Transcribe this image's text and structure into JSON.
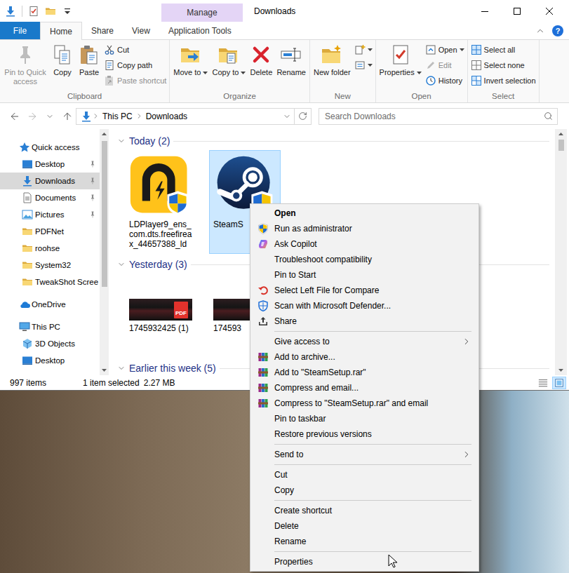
{
  "window": {
    "title": "Downloads",
    "context_tab": "Manage"
  },
  "ribbon": {
    "tabs": [
      {
        "label": "File",
        "kind": "file",
        "selected": false
      },
      {
        "label": "Home",
        "kind": "tab",
        "selected": true
      },
      {
        "label": "Share",
        "kind": "tab",
        "selected": false
      },
      {
        "label": "View",
        "kind": "tab",
        "selected": false
      },
      {
        "label": "Application Tools",
        "kind": "contextual",
        "selected": false
      }
    ],
    "help": "?",
    "groups": [
      {
        "label": "Clipboard",
        "buttons": [
          {
            "kind": "large",
            "label": "Pin to Quick access",
            "dropdown": false,
            "disabled": true
          },
          {
            "kind": "large",
            "label": "Copy",
            "dropdown": false,
            "disabled": false
          },
          {
            "kind": "large",
            "label": "Paste",
            "dropdown": false,
            "disabled": false
          },
          {
            "kind": "small",
            "label": "Cut",
            "dropdown": false,
            "disabled": false
          },
          {
            "kind": "small",
            "label": "Copy path",
            "dropdown": false,
            "disabled": false
          },
          {
            "kind": "small",
            "label": "Paste shortcut",
            "dropdown": false,
            "disabled": true
          }
        ]
      },
      {
        "label": "Organize",
        "buttons": [
          {
            "kind": "large",
            "label": "Move to",
            "dropdown": true,
            "disabled": false
          },
          {
            "kind": "large",
            "label": "Copy to",
            "dropdown": true,
            "disabled": false
          },
          {
            "kind": "large",
            "label": "Delete",
            "dropdown": false,
            "disabled": false
          },
          {
            "kind": "large",
            "label": "Rename",
            "dropdown": false,
            "disabled": false
          }
        ]
      },
      {
        "label": "New",
        "buttons": [
          {
            "kind": "large",
            "label": "New folder",
            "dropdown": false,
            "disabled": false
          },
          {
            "kind": "icon",
            "dropdown": true,
            "disabled": false
          },
          {
            "kind": "icon",
            "dropdown": true,
            "disabled": false
          }
        ]
      },
      {
        "label": "Open",
        "buttons": [
          {
            "kind": "large",
            "label": "Properties",
            "dropdown": true,
            "disabled": false
          },
          {
            "kind": "small",
            "label": "Open",
            "dropdown": true,
            "disabled": false
          },
          {
            "kind": "small",
            "label": "Edit",
            "dropdown": false,
            "disabled": true
          },
          {
            "kind": "small",
            "label": "History",
            "dropdown": false,
            "disabled": false
          }
        ]
      },
      {
        "label": "Select",
        "buttons": [
          {
            "kind": "small",
            "label": "Select all",
            "dropdown": false,
            "disabled": false
          },
          {
            "kind": "small",
            "label": "Select none",
            "dropdown": false,
            "disabled": false
          },
          {
            "kind": "small",
            "label": "Invert selection",
            "dropdown": false,
            "disabled": false
          }
        ]
      }
    ]
  },
  "address_bar": {
    "nav_buttons": [
      {
        "disabled": false
      },
      {
        "disabled": true
      }
    ],
    "path": [
      "This PC",
      "Downloads"
    ],
    "search_placeholder": "Search Downloads"
  },
  "navigation": {
    "sections": [
      {
        "label": "Quick access",
        "selected": false,
        "items": [
          {
            "label": "Desktop",
            "pinned": true,
            "selected": false
          },
          {
            "label": "Downloads",
            "pinned": true,
            "selected": true
          },
          {
            "label": "Documents",
            "pinned": true,
            "selected": false
          },
          {
            "label": "Pictures",
            "pinned": true,
            "selected": false
          },
          {
            "label": "PDFNet",
            "pinned": false,
            "selected": false
          },
          {
            "label": "roohse",
            "pinned": false,
            "selected": false
          },
          {
            "label": "System32",
            "pinned": false,
            "selected": false
          },
          {
            "label": "TweakShot Scree",
            "pinned": false,
            "selected": false
          }
        ]
      },
      {
        "label": "OneDrive",
        "selected": false,
        "items": []
      },
      {
        "label": "This PC",
        "selected": false,
        "items": [
          {
            "label": "3D Objects",
            "pinned": false,
            "selected": false
          },
          {
            "label": "Desktop",
            "pinned": false,
            "selected": false
          }
        ]
      }
    ]
  },
  "file_groups": [
    {
      "label": "Today (2)",
      "expanded": true,
      "files": [
        {
          "name": "LDPlayer9_ens_com.dts.freefireax_44657388_ld",
          "kind": "program",
          "selected": false
        },
        {
          "name": "SteamS",
          "kind": "program",
          "selected": true
        }
      ]
    },
    {
      "label": "Yesterday (3)",
      "expanded": true,
      "files": [
        {
          "name": "1745932425 (1)",
          "kind": "picture",
          "selected": false,
          "badge": "PDF"
        },
        {
          "name": "174593",
          "kind": "picture",
          "selected": false
        }
      ]
    },
    {
      "label": "Earlier this week (5)",
      "expanded": true,
      "files": []
    }
  ],
  "status_bar": {
    "count": "997 items",
    "selection": "1 item selected",
    "size": "2.27 MB",
    "views": [
      {
        "selected": false
      },
      {
        "selected": true
      }
    ]
  },
  "context_menu": {
    "sections": [
      {
        "items": [
          {
            "label": "Open",
            "default": true,
            "submenu": false
          },
          {
            "label": "Run as administrator",
            "default": false,
            "submenu": false
          },
          {
            "label": "Ask Copilot",
            "default": false,
            "submenu": false
          },
          {
            "label": "Troubleshoot compatibility",
            "default": false,
            "submenu": false
          },
          {
            "label": "Pin to Start",
            "default": false,
            "submenu": false
          },
          {
            "label": "Select Left File for Compare",
            "default": false,
            "submenu": false
          },
          {
            "label": "Scan with Microsoft Defender...",
            "default": false,
            "submenu": false
          },
          {
            "label": "Share",
            "default": false,
            "submenu": false
          }
        ]
      },
      {
        "items": [
          {
            "label": "Give access to",
            "default": false,
            "submenu": true
          },
          {
            "label": "Add to archive...",
            "default": false,
            "submenu": false
          },
          {
            "label": "Add to \"SteamSetup.rar\"",
            "default": false,
            "submenu": false
          },
          {
            "label": "Compress and email...",
            "default": false,
            "submenu": false
          },
          {
            "label": "Compress to \"SteamSetup.rar\" and email",
            "default": false,
            "submenu": false
          },
          {
            "label": "Pin to taskbar",
            "default": false,
            "submenu": false
          },
          {
            "label": "Restore previous versions",
            "default": false,
            "submenu": false
          }
        ]
      },
      {
        "items": [
          {
            "label": "Send to",
            "default": false,
            "submenu": true
          }
        ]
      },
      {
        "items": [
          {
            "label": "Cut",
            "default": false,
            "submenu": false
          },
          {
            "label": "Copy",
            "default": false,
            "submenu": false
          }
        ]
      },
      {
        "items": [
          {
            "label": "Create shortcut",
            "default": false,
            "submenu": false
          },
          {
            "label": "Delete",
            "default": false,
            "submenu": false
          },
          {
            "label": "Rename",
            "default": false,
            "submenu": false
          }
        ]
      },
      {
        "items": [
          {
            "label": "Properties",
            "default": false,
            "submenu": false
          }
        ]
      }
    ]
  }
}
